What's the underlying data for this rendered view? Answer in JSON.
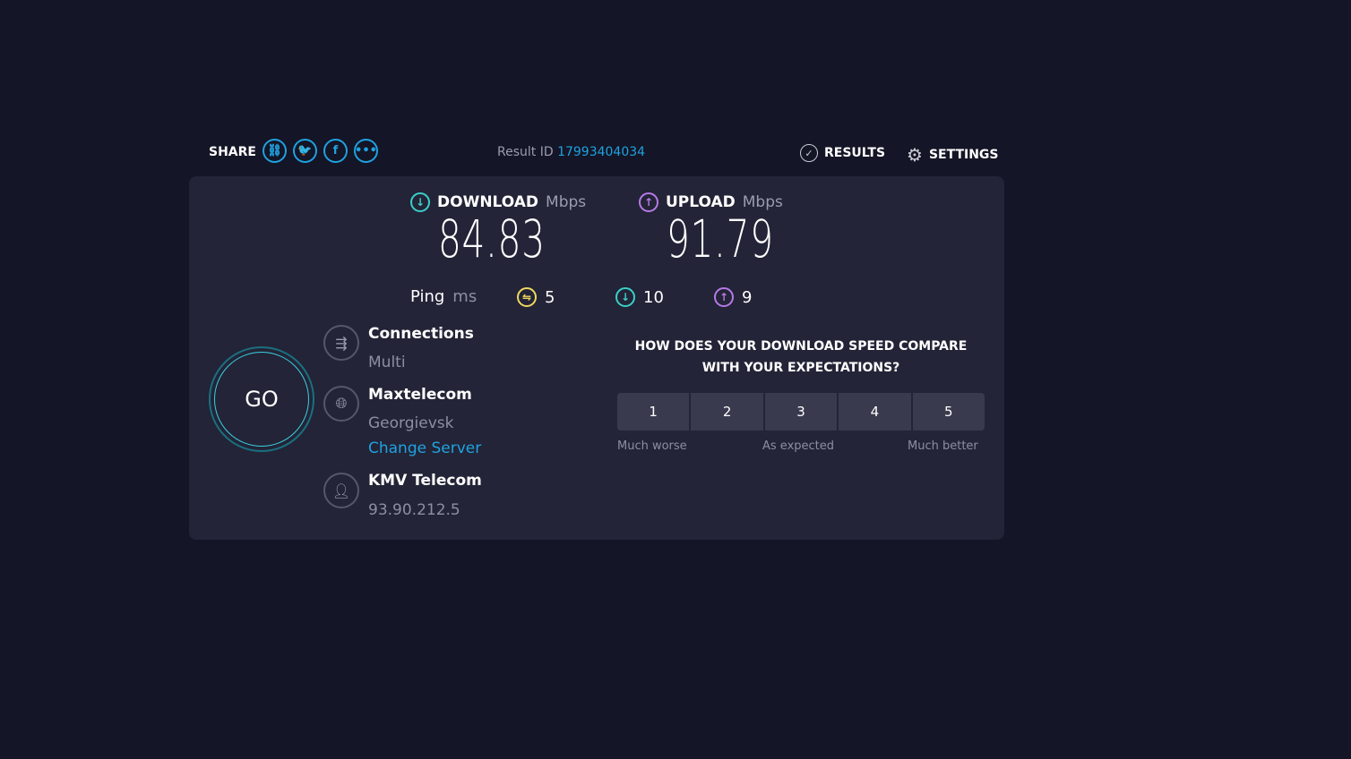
{
  "share": {
    "label": "SHARE",
    "icons": [
      "link-icon",
      "twitter-icon",
      "facebook-icon",
      "more-icon"
    ]
  },
  "result": {
    "label": "Result ID",
    "id": "17993404034"
  },
  "nav": {
    "results": "RESULTS",
    "settings": "SETTINGS"
  },
  "download": {
    "label": "DOWNLOAD",
    "unit": "Mbps",
    "value": "84.83"
  },
  "upload": {
    "label": "UPLOAD",
    "unit": "Mbps",
    "value": "91.79"
  },
  "ping": {
    "label": "Ping",
    "unit": "ms",
    "idle": "5",
    "download": "10",
    "upload": "9"
  },
  "go": "GO",
  "connections": {
    "title": "Connections",
    "value": "Multi"
  },
  "server": {
    "title": "Maxtelecom",
    "location": "Georgievsk",
    "change": "Change Server"
  },
  "isp": {
    "title": "KMV Telecom",
    "ip": "93.90.212.5"
  },
  "survey": {
    "question": "HOW DOES YOUR DOWNLOAD SPEED COMPARE WITH YOUR EXPECTATIONS?",
    "options": [
      "1",
      "2",
      "3",
      "4",
      "5"
    ],
    "low": "Much worse",
    "mid": "As expected",
    "high": "Much better"
  },
  "colors": {
    "bg": "#141526",
    "panel": "#232437",
    "accent": "#1fa2e0",
    "download": "#3ad0c8",
    "upload": "#b67ae8",
    "ping": "#f0d860"
  }
}
